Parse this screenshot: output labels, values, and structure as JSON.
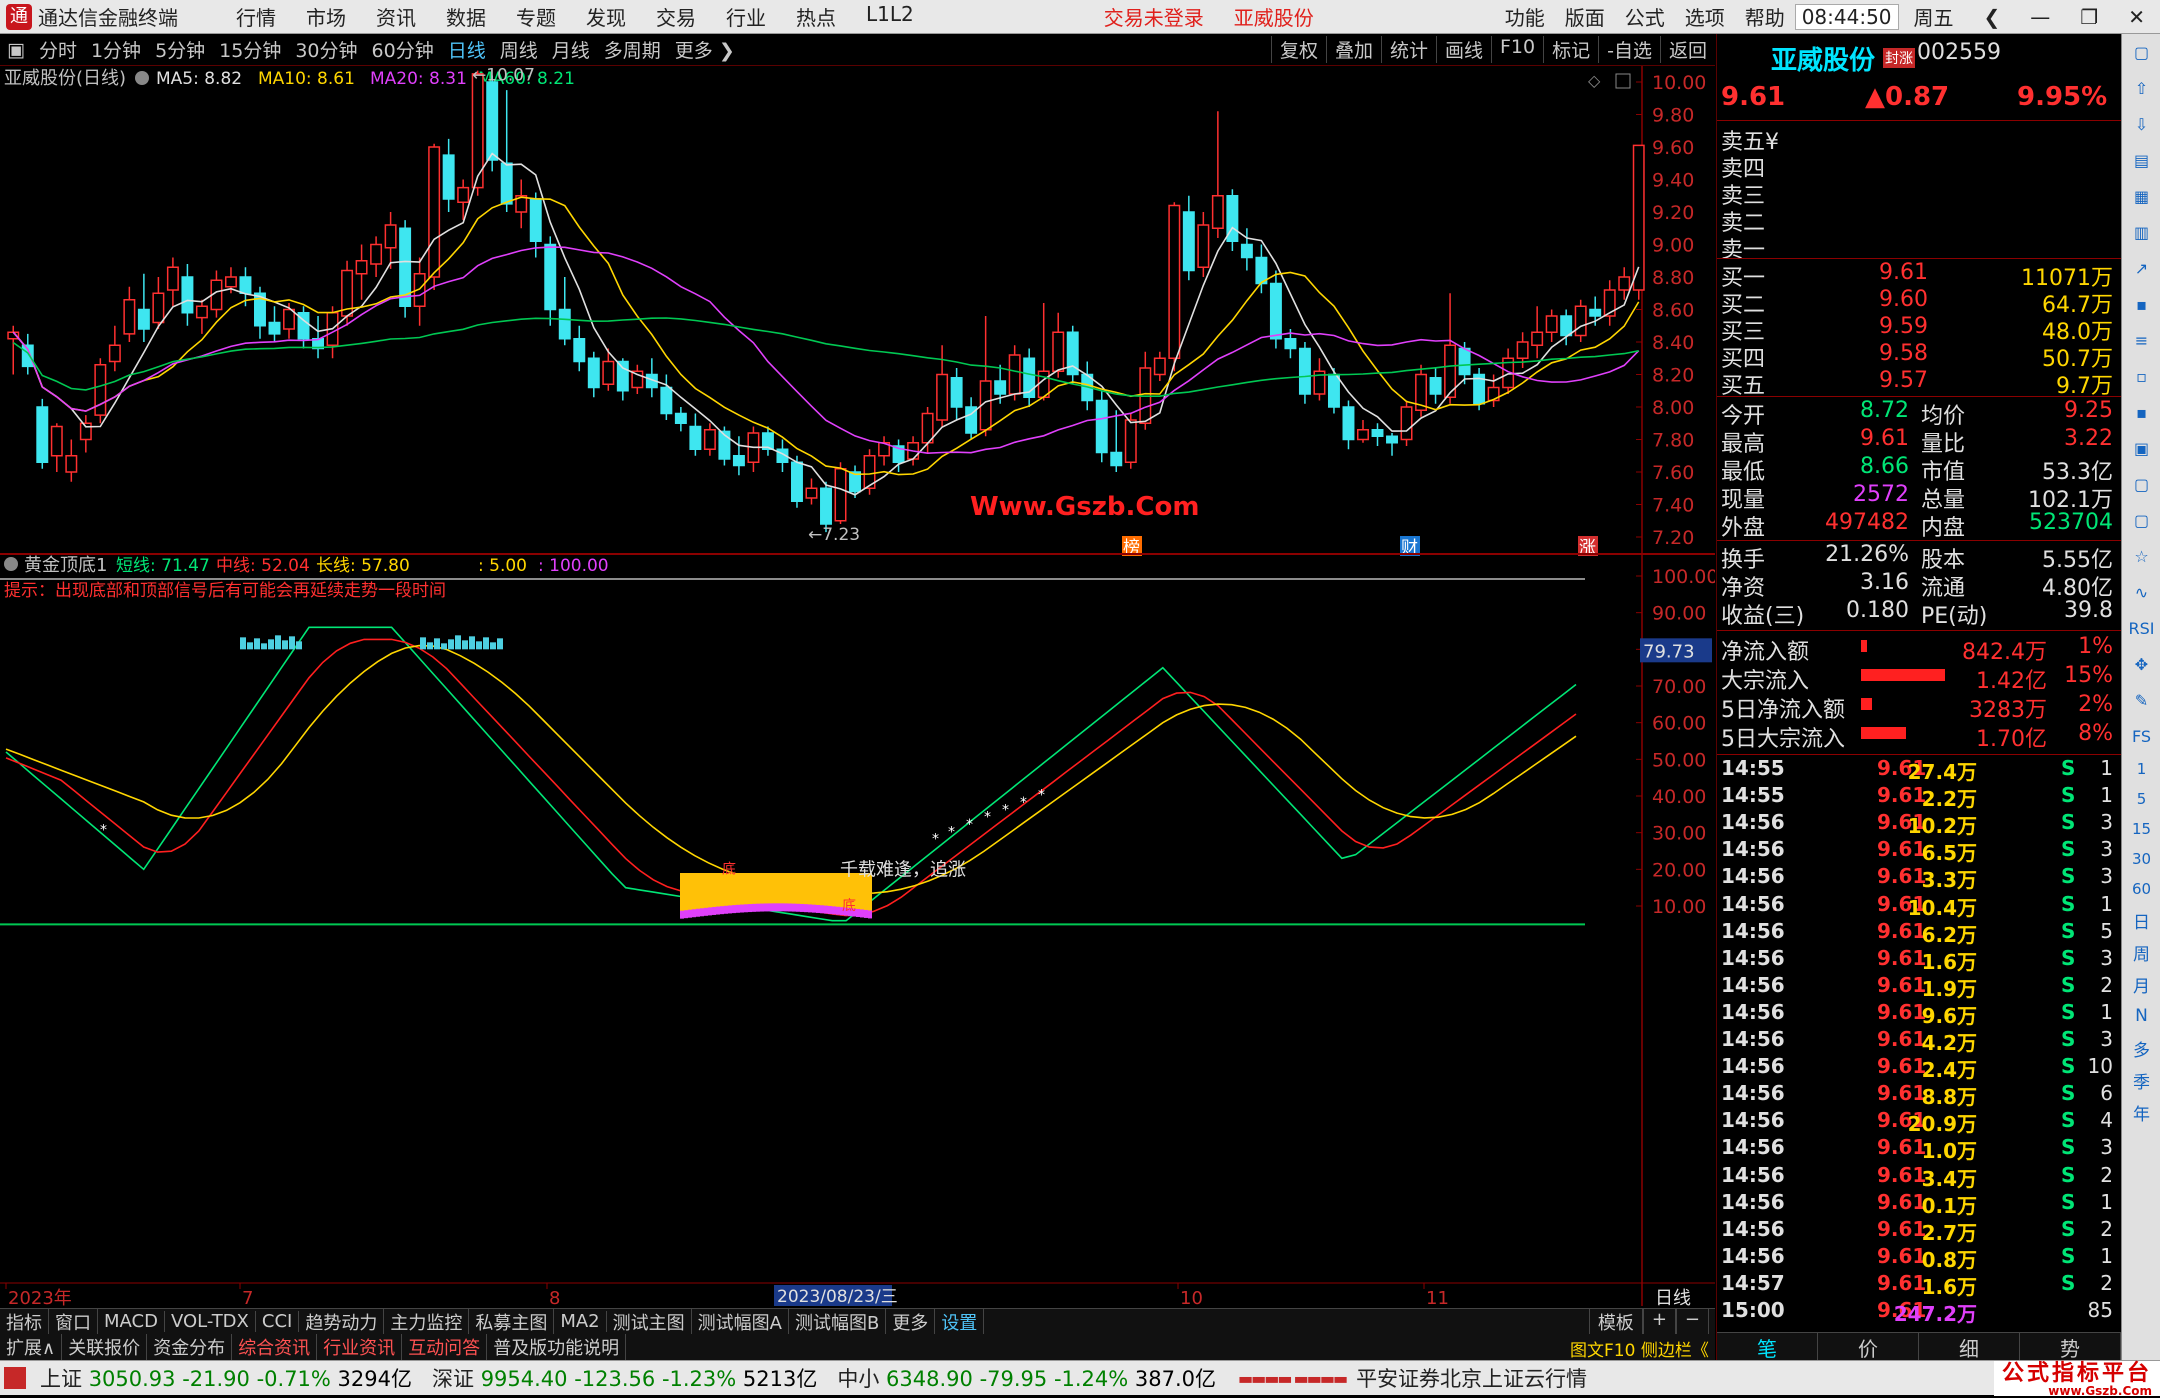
{
  "app": {
    "title": "通达信金融终端",
    "menu": [
      "行情",
      "市场",
      "资讯",
      "数据",
      "专题",
      "发现",
      "交易",
      "行业",
      "热点",
      "L1L2"
    ],
    "login": "交易未登录",
    "stock_title": "亚威股份",
    "menu_right": [
      "功能",
      "版面",
      "公式",
      "选项",
      "帮助"
    ],
    "time": "08:44:50",
    "weekday": "周五"
  },
  "period_bar": {
    "items": [
      "分时",
      "1分钟",
      "5分钟",
      "15分钟",
      "30分钟",
      "60分钟",
      "日线",
      "周线",
      "月线",
      "多周期",
      "更多"
    ],
    "active": "日线",
    "right": [
      "复权",
      "叠加",
      "统计",
      "画线",
      "F10",
      "标记",
      "-自选",
      "返回"
    ]
  },
  "kline": {
    "header": {
      "name": "亚威股份(日线)",
      "ma5": "MA5: 8.82",
      "ma10": "MA10: 8.61",
      "ma20": "MA20: 8.31",
      "ma60": "MA60: 8.21"
    },
    "y_ticks": [
      10.0,
      9.8,
      9.6,
      9.4,
      9.2,
      9.0,
      8.8,
      8.6,
      8.4,
      8.2,
      8.0,
      7.8,
      7.6,
      7.4,
      7.2
    ],
    "y_tick_labels": [
      "10.00",
      "9.80",
      "9.60",
      "9.40",
      "9.20",
      "9.00",
      "8.80",
      "8.60",
      "8.40",
      "8.20",
      "8.00",
      "7.80",
      "7.60",
      "7.40",
      "7.20"
    ],
    "high_label": "10.07",
    "low_label": "7.23",
    "watermark": "Www.Gszb.Com",
    "event_labels": [
      "榜",
      "财",
      "涨"
    ]
  },
  "indicator": {
    "name": "黄金顶底1",
    "short": "短线: 71.47",
    "mid": "中线: 52.04",
    "long": "长线: 57.80",
    "p1": ": 5.00",
    "p2": ": 100.00",
    "tip": "提示：出现底部和顶部信号后有可能会再延续走势一段时间",
    "y_ticks": [
      100,
      90,
      80,
      70,
      60,
      50,
      40,
      30,
      20,
      10
    ],
    "y_tick_labels": [
      "100.00",
      "90.00",
      "80.00",
      "70.00",
      "60.00",
      "50.00",
      "40.00",
      "30.00",
      "20.00",
      "10.00"
    ],
    "current": "79.73",
    "annotation": "千载难逢，追涨",
    "bottom_marks": [
      "底",
      "底"
    ]
  },
  "dates": {
    "labels": [
      "2023年",
      "7",
      "8",
      "10",
      "11"
    ],
    "selected": "2023/08/23/三",
    "period": "日线"
  },
  "indicator_tabs": {
    "items": [
      "指标",
      "窗口",
      "MACD",
      "VOL-TDX",
      "CCI",
      "趋势动力",
      "主力监控",
      "私募主图",
      "MA2",
      "测试主图",
      "测试幅图A",
      "测试幅图B",
      "更多",
      "设置"
    ],
    "active": "设置",
    "right": [
      "模板",
      "+",
      "−"
    ]
  },
  "ext_tabs": {
    "items": [
      "扩展∧",
      "关联报价",
      "资金分布",
      "综合资讯",
      "行业资讯",
      "互动问答",
      "普及版功能说明"
    ],
    "highlight": [
      "综合资讯",
      "行业资讯",
      "互动问答"
    ]
  },
  "quote": {
    "name": "亚威股份",
    "badge": "封涨",
    "code": "002559",
    "price": "9.61",
    "change": "▲0.87",
    "pct": "9.95%",
    "sells": [
      {
        "label": "卖五",
        "v": "¥",
        "p": "",
        "q": ""
      },
      {
        "label": "卖四",
        "p": "",
        "q": ""
      },
      {
        "label": "卖三",
        "p": "",
        "q": ""
      },
      {
        "label": "卖二",
        "p": "",
        "q": ""
      },
      {
        "label": "卖一",
        "p": "",
        "q": ""
      }
    ],
    "buys": [
      {
        "label": "买一",
        "p": "9.61",
        "q": "11071万"
      },
      {
        "label": "买二",
        "p": "9.60",
        "q": "64.7万"
      },
      {
        "label": "买三",
        "p": "9.59",
        "q": "48.0万"
      },
      {
        "label": "买四",
        "p": "9.58",
        "q": "50.7万"
      },
      {
        "label": "买五",
        "p": "9.57",
        "q": "9.7万"
      }
    ],
    "stats": [
      {
        "l1": "今开",
        "v1": "8.72",
        "l2": "均价",
        "v2": "9.25"
      },
      {
        "l1": "最高",
        "v1": "9.61",
        "l2": "量比",
        "v2": "3.22"
      },
      {
        "l1": "最低",
        "v1": "8.66",
        "l2": "市值",
        "v2": "53.3亿"
      },
      {
        "l1": "现量",
        "v1": "2572",
        "l2": "总量",
        "v2": "102.1万"
      },
      {
        "l1": "外盘",
        "v1": "497482",
        "l2": "内盘",
        "v2": "523704"
      }
    ],
    "fund": [
      {
        "l1": "换手",
        "v1": "21.26%",
        "l2": "股本",
        "v2": "5.55亿"
      },
      {
        "l1": "净资",
        "v1": "3.16",
        "l2": "流通",
        "v2": "4.80亿"
      },
      {
        "l1": "收益(三)",
        "v1": "0.180",
        "l2": "PE(动)",
        "v2": "39.8"
      }
    ],
    "flows": [
      {
        "label": "净流入额",
        "val": "842.4万",
        "pct": "1%",
        "bar": 0.01
      },
      {
        "label": "大宗流入",
        "val": "1.42亿",
        "pct": "15%",
        "bar": 0.15
      },
      {
        "label": "5日净流入额",
        "val": "3283万",
        "pct": "2%",
        "bar": 0.02
      },
      {
        "label": "5日大宗流入",
        "val": "1.70亿",
        "pct": "8%",
        "bar": 0.08
      }
    ],
    "ticks": [
      [
        "14:55",
        "9.61",
        "27.4万",
        "S",
        "1"
      ],
      [
        "14:55",
        "9.61",
        "2.2万",
        "S",
        "1"
      ],
      [
        "14:56",
        "9.61",
        "10.2万",
        "S",
        "3"
      ],
      [
        "14:56",
        "9.61",
        "6.5万",
        "S",
        "3"
      ],
      [
        "14:56",
        "9.61",
        "3.3万",
        "S",
        "3"
      ],
      [
        "14:56",
        "9.61",
        "10.4万",
        "S",
        "1"
      ],
      [
        "14:56",
        "9.61",
        "6.2万",
        "S",
        "5"
      ],
      [
        "14:56",
        "9.61",
        "1.6万",
        "S",
        "3"
      ],
      [
        "14:56",
        "9.61",
        "1.9万",
        "S",
        "2"
      ],
      [
        "14:56",
        "9.61",
        "9.6万",
        "S",
        "1"
      ],
      [
        "14:56",
        "9.61",
        "4.2万",
        "S",
        "3"
      ],
      [
        "14:56",
        "9.61",
        "2.4万",
        "S",
        "10"
      ],
      [
        "14:56",
        "9.61",
        "8.8万",
        "S",
        "6"
      ],
      [
        "14:56",
        "9.61",
        "20.9万",
        "S",
        "4"
      ],
      [
        "14:56",
        "9.61",
        "1.0万",
        "S",
        "3"
      ],
      [
        "14:56",
        "9.61",
        "3.4万",
        "S",
        "2"
      ],
      [
        "14:56",
        "9.61",
        "0.1万",
        "S",
        "1"
      ],
      [
        "14:56",
        "9.61",
        "2.7万",
        "S",
        "2"
      ],
      [
        "14:56",
        "9.61",
        "0.8万",
        "S",
        "1"
      ],
      [
        "14:57",
        "9.61",
        "1.6万",
        "S",
        "2"
      ],
      [
        "15:00",
        "9.61",
        "247.2万",
        "",
        "85"
      ]
    ],
    "bottom_tabs": [
      "笔",
      "价",
      "细",
      "势"
    ],
    "f10": "图文F10",
    "side_bar": "侧边栏《"
  },
  "side_toolbar": [
    "日",
    "周",
    "月",
    "N",
    "多",
    "季",
    "年"
  ],
  "side_toolbar_nums": [
    "1",
    "5",
    "15",
    "30",
    "60"
  ],
  "status": {
    "indices": [
      {
        "name": "上证",
        "v": "3050.93",
        "c": "-21.90",
        "p": "-0.71%",
        "amt": "3294亿"
      },
      {
        "name": "深证",
        "v": "9954.40",
        "c": "-123.56",
        "p": "-1.23%",
        "amt": "5213亿"
      },
      {
        "name": "中小",
        "v": "6348.90",
        "c": "-79.95",
        "p": "-1.24%",
        "amt": "387.0亿"
      }
    ],
    "server": "平安证券北京上证云行情",
    "brand": "公式指标平台",
    "brand_url": "www.Gszb.Com"
  },
  "chart_data": [
    {
      "type": "line",
      "title": "亚威股份(日线)",
      "ylim": [
        7.2,
        10.0
      ],
      "series": [
        {
          "name": "MA5",
          "values": [
            8.82
          ]
        },
        {
          "name": "MA10",
          "values": [
            8.61
          ]
        },
        {
          "name": "MA20",
          "values": [
            8.31
          ]
        },
        {
          "name": "MA60",
          "values": [
            8.21
          ]
        }
      ],
      "high": 10.07,
      "low": 7.23
    },
    {
      "type": "line",
      "title": "黄金顶底1",
      "ylim": [
        0,
        100
      ],
      "series": [
        {
          "name": "短线",
          "values": [
            71.47
          ]
        },
        {
          "name": "中线",
          "values": [
            52.04
          ]
        },
        {
          "name": "长线",
          "values": [
            57.8
          ]
        }
      ]
    }
  ]
}
